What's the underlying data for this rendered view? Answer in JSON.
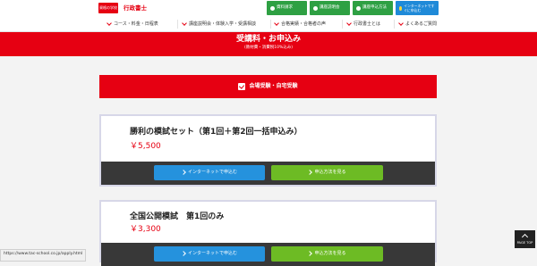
{
  "header": {
    "logo_text": "資格の学校TAC",
    "brand": "行政書士",
    "buttons": [
      {
        "label": "資料請求",
        "color": "green"
      },
      {
        "label": "講座説明会",
        "color": "green"
      },
      {
        "label": "講座申込方法",
        "color": "green"
      },
      {
        "label": "インターネットですぐに申込む",
        "color": "blue"
      }
    ]
  },
  "nav": {
    "items": [
      "コース・料金・日程表",
      "講座説明会・体験入学・受講相談",
      "合格実績・合格者の声",
      "行政書士とは",
      "よくあるご質問"
    ]
  },
  "banner": {
    "title": "受講料・お申込み",
    "subtitle": "(教材費・消費税10%込み)"
  },
  "section": {
    "label": "会場受験・自宅受験"
  },
  "courses": [
    {
      "title": "勝利の模試セット（第1回＋第2回一括申込み）",
      "price": "￥5,500",
      "button_internet": "インターネットで申込む",
      "button_method": "申込方法を見る"
    },
    {
      "title": "全国公開模試　第1回のみ",
      "price": "￥3,300",
      "button_internet": "インターネットで申込む",
      "button_method": "申込方法を見る"
    }
  ],
  "status_url": "https://www.tac-school.co.jp/apply.html",
  "page_top": "PAGE TOP",
  "colors": {
    "brand_red": "#e60012",
    "header_green": "#2ea043",
    "header_blue": "#1f8ad8",
    "button_blue": "#2592dd",
    "button_green": "#6dbb24",
    "band_dark": "#383838"
  }
}
